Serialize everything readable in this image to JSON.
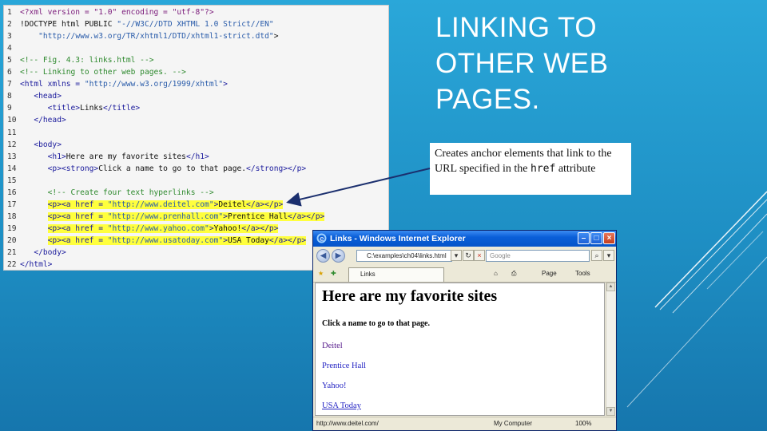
{
  "slide": {
    "title_lines": [
      "LINKING TO",
      "OTHER WEB",
      "PAGES."
    ]
  },
  "callout": {
    "text_before": "Creates anchor elements that link to the URL specified in the",
    "code": "href",
    "text_after": "attribute"
  },
  "code": {
    "line_numbers": [
      "1",
      "2",
      "3",
      "4",
      "5",
      "6",
      "7",
      "8",
      "9",
      "10",
      "11",
      "12",
      "13",
      "14",
      "15",
      "16",
      "17",
      "18",
      "19",
      "20",
      "21",
      "22"
    ],
    "lines": [
      "<?xml version = \"1.0\" encoding = \"utf-8\"?>",
      "<!DOCTYPE html PUBLIC \"-//W3C//DTD XHTML 1.0 Strict//EN\"",
      "    \"http://www.w3.org/TR/xhtml1/DTD/xhtml1-strict.dtd\">",
      "",
      "<!-- Fig. 4.3: links.html -->",
      "<!-- Linking to other web pages. -->",
      "<html xmlns = \"http://www.w3.org/1999/xhtml\">",
      "   <head>",
      "      <title>Links</title>",
      "   </head>",
      "",
      "   <body>",
      "      <h1>Here are my favorite sites</h1>",
      "      <p><strong>Click a name to go to that page.</strong></p>",
      "",
      "      <!-- Create four text hyperlinks -->",
      "      <p><a href = \"http://www.deitel.com\">Deitel</a></p>",
      "      <p><a href = \"http://www.prenhall.com\">Prentice Hall</a></p>",
      "      <p><a href = \"http://www.yahoo.com\">Yahoo!</a></p>",
      "      <p><a href = \"http://www.usatoday.com\">USA Today</a></p>",
      "   </body>",
      "</html>"
    ]
  },
  "browser": {
    "window_title": "Links - Windows Internet Explorer",
    "address": "C:\\examples\\ch04\\links.html",
    "search_placeholder": "Google",
    "tab_label": "Links",
    "page_menu": "Page",
    "tools_menu": "Tools",
    "heading": "Here are my favorite sites",
    "instruction": "Click a name to go to that page.",
    "links": [
      "Deitel",
      "Prentice Hall",
      "Yahoo!",
      "USA Today"
    ],
    "status_url": "http://www.deitel.com/",
    "status_zone": "My Computer",
    "status_zoom": "100%"
  }
}
